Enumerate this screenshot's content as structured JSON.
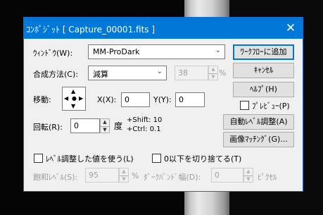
{
  "window": {
    "title": "ｺﾝﾎﾟｼﾞｯﾄ [ Capture_00001.fits ]",
    "close_glyph": "✕"
  },
  "window_row": {
    "label": "ｳｨﾝﾄﾞｳ(W):",
    "value": "MM-ProDark",
    "button": "ﾜｰｸﾌﾛｰに追加"
  },
  "method_row": {
    "label": "合成方法(C):",
    "value": "減算",
    "percent_value": "38",
    "percent_unit": "%"
  },
  "move_row": {
    "label": "移動:",
    "x_label": "X(X):",
    "x_value": "0",
    "y_label": "Y(Y):",
    "y_value": "0"
  },
  "rotate_row": {
    "label": "回転(R):",
    "value": "0",
    "unit": "度",
    "shift_hint": "+Shift: 10",
    "ctrl_hint": "+Ctrl: 0.1"
  },
  "buttons": {
    "cancel": "ｷｬﾝｾﾙ",
    "help": "ﾍﾙﾌﾟ(H)",
    "preview": "ﾌﾟﾚﾋﾞｭｰ(P)",
    "auto_level": "自動ﾚﾍﾞﾙ調整(A)",
    "image_matching": "画像ﾏｯﾁﾝｸﾞ(G)..."
  },
  "options": {
    "use_level_adjusted": "ﾚﾍﾞﾙ調整した値を使う(L)",
    "truncate_below_zero": "0以下を切り捨てる(T)"
  },
  "saturation_row": {
    "label": "飽和ﾚﾍﾞﾙ(S):",
    "value": "95",
    "unit": "%",
    "dark_band_label": "ﾀﾞｰｸﾊﾞﾝﾄﾞ幅(D):",
    "dark_band_value": "0",
    "dark_band_unit": "ﾋﾟｸｾﾙ"
  },
  "direction_pad": {
    "up": "▲",
    "down": "▼",
    "left": "◀",
    "right": "▶",
    "center": "●"
  },
  "colors": {
    "titlebar": "#0078d7",
    "dialog_bg": "#f0f0f0"
  }
}
